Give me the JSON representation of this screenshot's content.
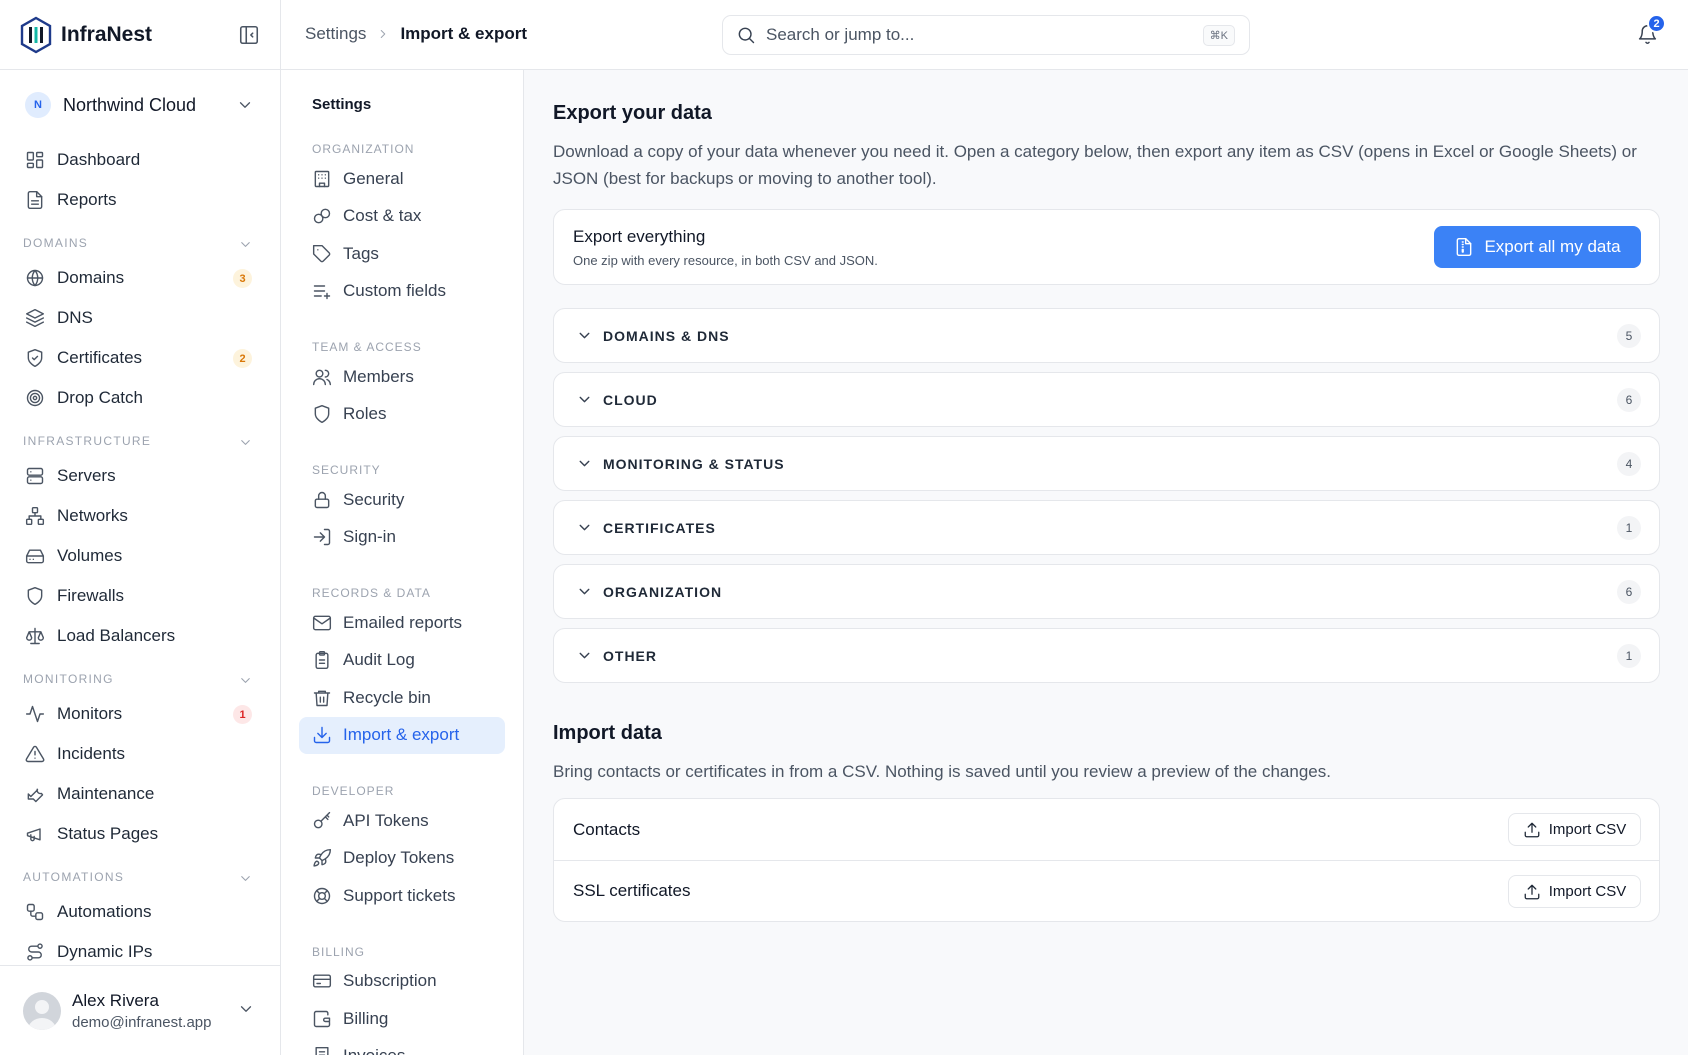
{
  "brand": {
    "name": "InfraNest"
  },
  "org": {
    "initial": "N",
    "name": "Northwind Cloud"
  },
  "sidebar": {
    "top": [
      {
        "label": "Dashboard",
        "icon": "dashboard-icon"
      },
      {
        "label": "Reports",
        "icon": "reports-icon"
      }
    ],
    "sections": [
      {
        "title": "DOMAINS",
        "items": [
          {
            "label": "Domains",
            "icon": "globe-icon",
            "badge": "3",
            "badge_color": "orange"
          },
          {
            "label": "DNS",
            "icon": "layers-icon"
          },
          {
            "label": "Certificates",
            "icon": "shield-check-icon",
            "badge": "2",
            "badge_color": "orange"
          },
          {
            "label": "Drop Catch",
            "icon": "target-icon"
          }
        ]
      },
      {
        "title": "INFRASTRUCTURE",
        "items": [
          {
            "label": "Servers",
            "icon": "server-icon"
          },
          {
            "label": "Networks",
            "icon": "network-icon"
          },
          {
            "label": "Volumes",
            "icon": "hard-drive-icon"
          },
          {
            "label": "Firewalls",
            "icon": "shield-icon"
          },
          {
            "label": "Load Balancers",
            "icon": "scale-icon"
          }
        ]
      },
      {
        "title": "MONITORING",
        "items": [
          {
            "label": "Monitors",
            "icon": "activity-icon",
            "badge": "1",
            "badge_color": "red"
          },
          {
            "label": "Incidents",
            "icon": "alert-triangle-icon"
          },
          {
            "label": "Maintenance",
            "icon": "wrench-icon"
          },
          {
            "label": "Status Pages",
            "icon": "megaphone-icon"
          }
        ]
      },
      {
        "title": "AUTOMATIONS",
        "items": [
          {
            "label": "Automations",
            "icon": "workflow-icon"
          },
          {
            "label": "Dynamic IPs",
            "icon": "route-icon"
          }
        ]
      }
    ]
  },
  "user": {
    "name": "Alex Rivera",
    "email": "demo@infranest.app"
  },
  "topbar": {
    "breadcrumb": [
      "Settings",
      "Import & export"
    ],
    "search_placeholder": "Search or jump to...",
    "search_shortcut": "⌘K",
    "notifications": "2"
  },
  "settings_nav": {
    "title": "Settings",
    "sections": [
      {
        "title": "ORGANIZATION",
        "items": [
          {
            "label": "General",
            "icon": "building-icon"
          },
          {
            "label": "Cost & tax",
            "icon": "coins-icon"
          },
          {
            "label": "Tags",
            "icon": "tag-icon"
          },
          {
            "label": "Custom fields",
            "icon": "list-plus-icon"
          }
        ]
      },
      {
        "title": "TEAM & ACCESS",
        "items": [
          {
            "label": "Members",
            "icon": "users-icon"
          },
          {
            "label": "Roles",
            "icon": "shield-icon"
          }
        ]
      },
      {
        "title": "SECURITY",
        "items": [
          {
            "label": "Security",
            "icon": "lock-icon"
          },
          {
            "label": "Sign-in",
            "icon": "log-in-icon"
          }
        ]
      },
      {
        "title": "RECORDS & DATA",
        "items": [
          {
            "label": "Emailed reports",
            "icon": "mail-icon"
          },
          {
            "label": "Audit Log",
            "icon": "clipboard-icon"
          },
          {
            "label": "Recycle bin",
            "icon": "trash-icon"
          },
          {
            "label": "Import & export",
            "icon": "download-icon",
            "active": true
          }
        ]
      },
      {
        "title": "DEVELOPER",
        "items": [
          {
            "label": "API Tokens",
            "icon": "key-icon"
          },
          {
            "label": "Deploy Tokens",
            "icon": "rocket-icon"
          },
          {
            "label": "Support tickets",
            "icon": "life-buoy-icon"
          }
        ]
      },
      {
        "title": "BILLING",
        "items": [
          {
            "label": "Subscription",
            "icon": "credit-card-icon"
          },
          {
            "label": "Billing",
            "icon": "wallet-icon"
          },
          {
            "label": "Invoices",
            "icon": "receipt-icon"
          }
        ]
      }
    ]
  },
  "export": {
    "title": "Export your data",
    "description": "Download a copy of your data whenever you need it. Open a category below, then export any item as CSV (opens in Excel or Google Sheets) or JSON (best for backups or moving to another tool).",
    "all": {
      "title": "Export everything",
      "subtitle": "One zip with every resource, in both CSV and JSON.",
      "button": "Export all my data"
    },
    "categories": [
      {
        "label": "DOMAINS & DNS",
        "count": "5"
      },
      {
        "label": "CLOUD",
        "count": "6"
      },
      {
        "label": "MONITORING & STATUS",
        "count": "4"
      },
      {
        "label": "CERTIFICATES",
        "count": "1"
      },
      {
        "label": "ORGANIZATION",
        "count": "6"
      },
      {
        "label": "OTHER",
        "count": "1"
      }
    ]
  },
  "import": {
    "title": "Import data",
    "description": "Bring contacts or certificates in from a CSV. Nothing is saved until you review a preview of the changes.",
    "rows": [
      {
        "label": "Contacts",
        "button": "Import CSV"
      },
      {
        "label": "SSL certificates",
        "button": "Import CSV"
      }
    ]
  },
  "colors": {
    "accent": "#3b82f6",
    "active_bg": "#e5effd",
    "badge_orange": "#d97706",
    "badge_red": "#dc2626"
  }
}
